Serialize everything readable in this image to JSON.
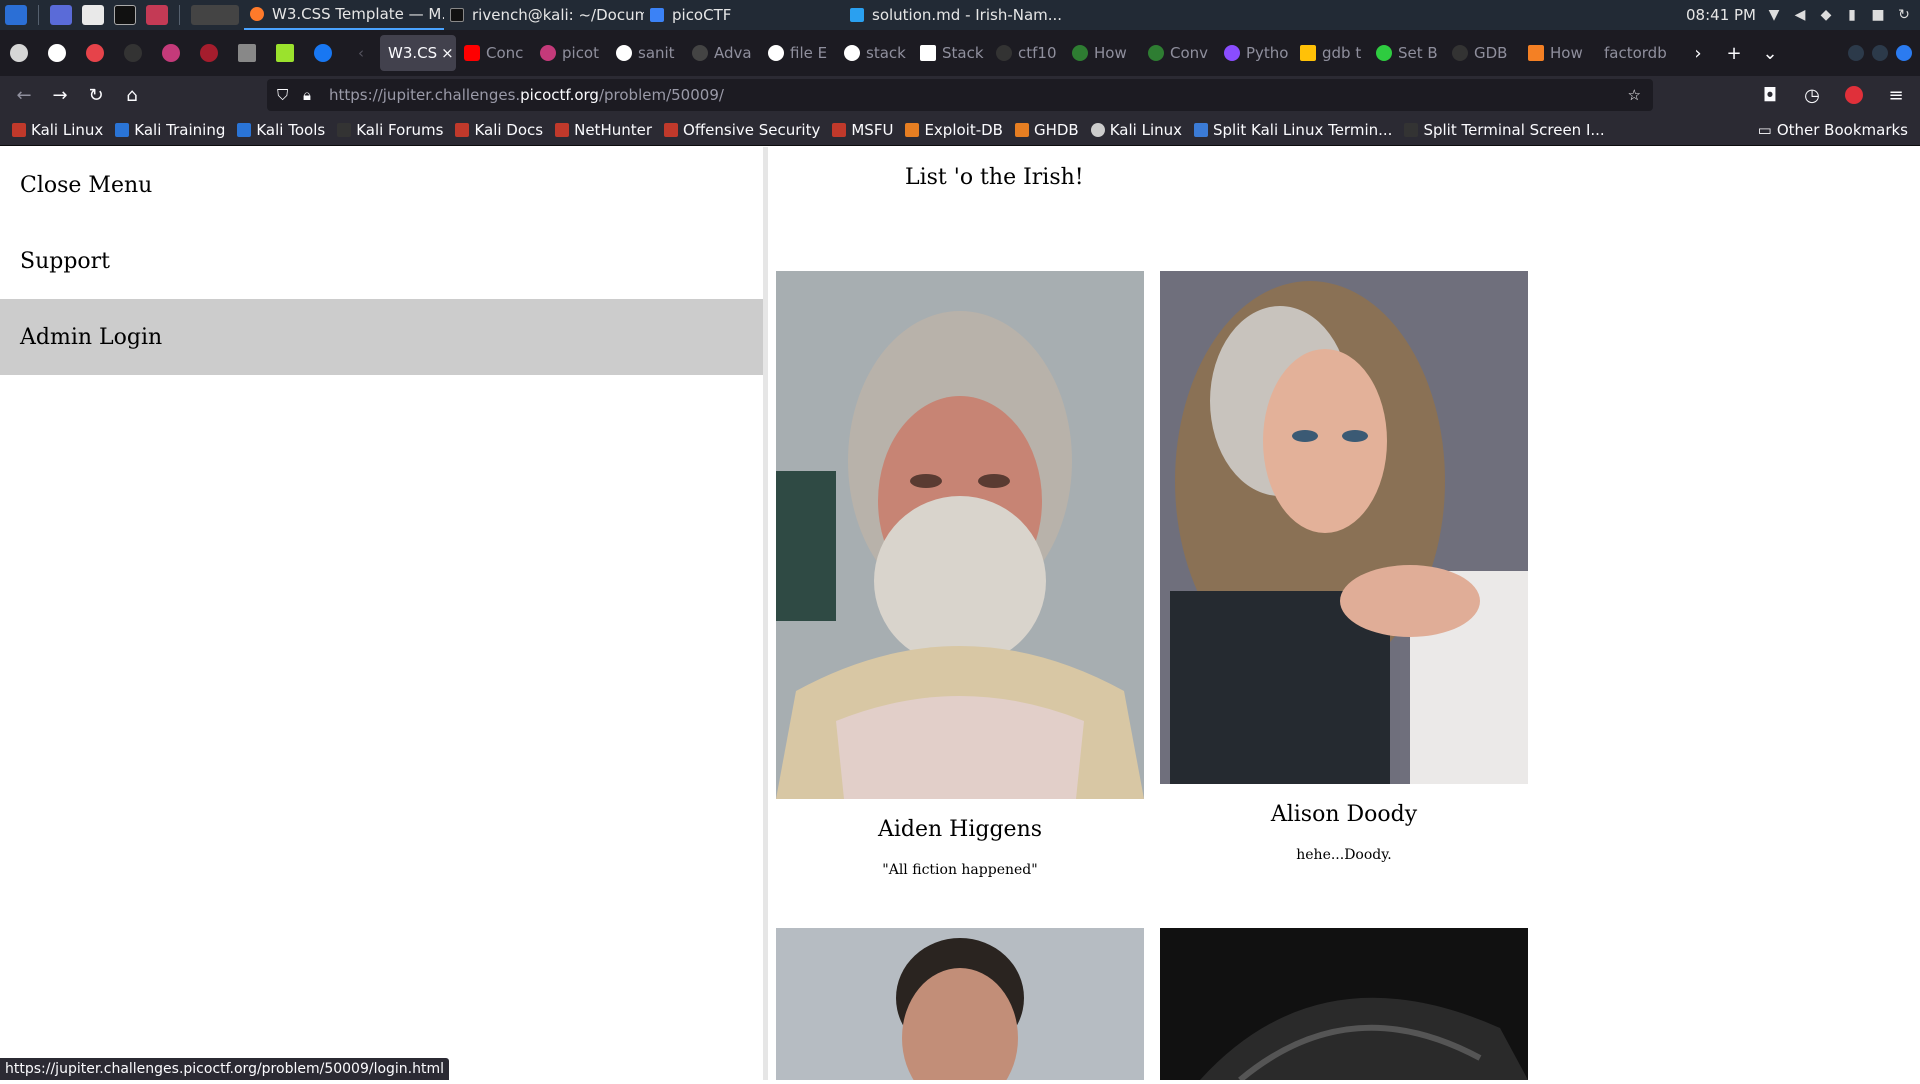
{
  "taskbar": {
    "windows": [
      {
        "label": "W3.CSS Template — M...",
        "icon": "firefox-icon",
        "active": true
      },
      {
        "label": "rivench@kali: ~/Docum...",
        "icon": "terminal-icon"
      },
      {
        "label": "picoCTF",
        "icon": "folder-icon"
      },
      {
        "label": "solution.md - Irish-Nam...",
        "icon": "vscode-icon"
      }
    ],
    "clock": "08:41 PM"
  },
  "tabs": {
    "active_label": "W3.CS",
    "items": [
      "Conc",
      "picot",
      "sanit",
      "Adva",
      "file E",
      "stack",
      "Stack",
      "ctf10",
      "How",
      "Conv",
      "Pytho",
      "gdb t",
      "Set B",
      "GDB",
      "How",
      "factordb"
    ]
  },
  "nav": {
    "url_prefix": "https://jupiter.challenges.",
    "url_domain": "picoctf.org",
    "url_suffix": "/problem/50009/"
  },
  "bookmarks": {
    "items": [
      "Kali Linux",
      "Kali Training",
      "Kali Tools",
      "Kali Forums",
      "Kali Docs",
      "NetHunter",
      "Offensive Security",
      "MSFU",
      "Exploit-DB",
      "GHDB",
      "Kali Linux",
      "Split Kali Linux Termin...",
      "Split Terminal Screen I..."
    ],
    "other": "Other Bookmarks"
  },
  "sidebar": {
    "close": "Close Menu",
    "support": "Support",
    "admin": "Admin Login"
  },
  "page": {
    "title": "List 'o the Irish!",
    "people": [
      {
        "name": "Aiden Higgens",
        "quote": "\"All fiction happened\""
      },
      {
        "name": "Alison Doody",
        "quote": "hehe...Doody."
      }
    ]
  },
  "status": "https://jupiter.challenges.picoctf.org/problem/50009/login.html"
}
